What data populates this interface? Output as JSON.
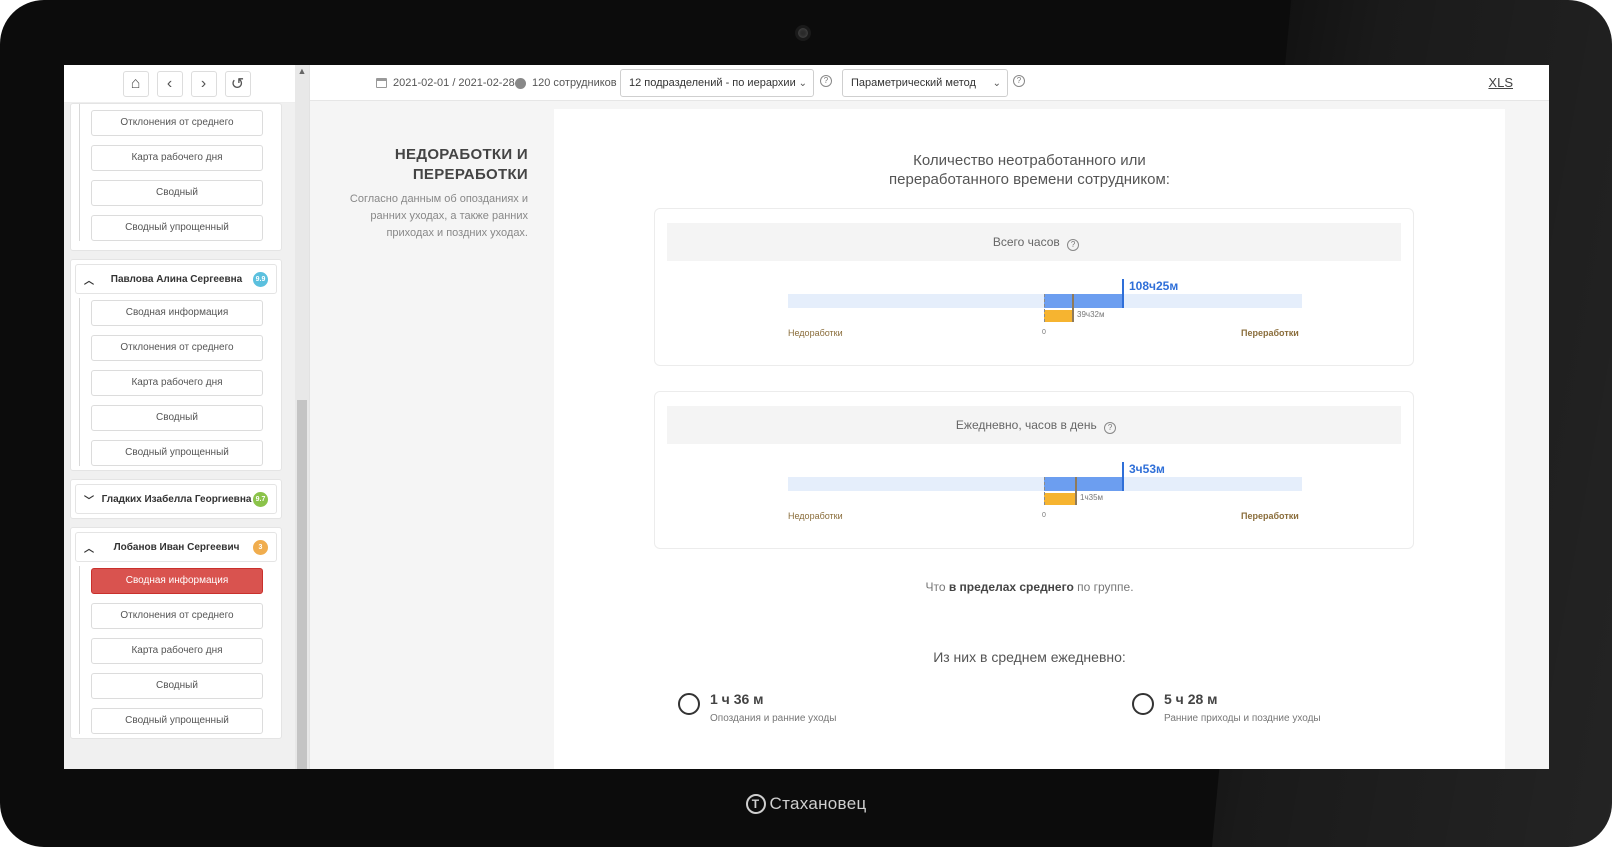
{
  "brand": {
    "name": "Стахановец"
  },
  "sidebar": {
    "group1": {
      "items": [
        "Отклонения от среднего",
        "Карта рабочего дня",
        "Сводный",
        "Сводный упрощенный"
      ]
    },
    "employees": [
      {
        "name": "Павлова Алина Сергеевна",
        "badge": "9.9",
        "badge_color": "#5bc0de",
        "expanded": true,
        "items": [
          "Сводная информация",
          "Отклонения от среднего",
          "Карта рабочего дня",
          "Сводный",
          "Сводный упрощенный"
        ]
      },
      {
        "name": "Гладких Изабелла Георгиевна",
        "badge": "9.7",
        "badge_color": "#8bc34a",
        "expanded": false,
        "items": []
      },
      {
        "name": "Лобанов Иван Сергеевич",
        "badge": "3",
        "badge_color": "#f0ad4e",
        "expanded": true,
        "items": [
          "Сводная информация",
          "Отклонения от среднего",
          "Карта рабочего дня",
          "Сводный",
          "Сводный упрощенный"
        ],
        "active_index": 0
      }
    ]
  },
  "topbar": {
    "date_range": "2021-02-01 / 2021-02-28",
    "employees": "120 сотрудников",
    "department_select": "12 подразделений - по иерархии",
    "method_select": "Параметрический метод",
    "xls": "XLS"
  },
  "left_info": {
    "title_line1": "НЕДОРАБОТКИ И",
    "title_line2": "ПЕРЕРАБОТКИ",
    "description": "Согласно данным об опозданиях и ранних уходах, а также ранних приходах и поздних уходах."
  },
  "panel": {
    "title_line1": "Количество неотработанного или",
    "title_line2": "переработанного времени сотрудником:",
    "cards": [
      {
        "header": "Всего часов",
        "overtime": "108ч25м",
        "undertime": "39ч32м",
        "overtime_fraction": 0.154,
        "undertime_fraction": 0.056,
        "left_label": "Недоработки",
        "right_label": "Переработки",
        "zero": "0"
      },
      {
        "header": "Ежедневно, часов в день",
        "overtime": "3ч53м",
        "undertime": "1ч35м",
        "overtime_fraction": 0.154,
        "undertime_fraction": 0.062,
        "left_label": "Недоработки",
        "right_label": "Переработки",
        "zero": "0"
      }
    ],
    "note_prefix": "Что ",
    "note_bold": "в пределах среднего",
    "note_suffix": " по группе.",
    "subtitle": "Из них в среднем ежедневно:",
    "stats": [
      {
        "value": "1 ч 36 м",
        "label": "Опоздания и ранние уходы",
        "icon": "stopwatch-icon"
      },
      {
        "value": "5 ч 28 м",
        "label": "Ранние приходы и поздние уходы",
        "icon": "clock-icon"
      }
    ]
  }
}
